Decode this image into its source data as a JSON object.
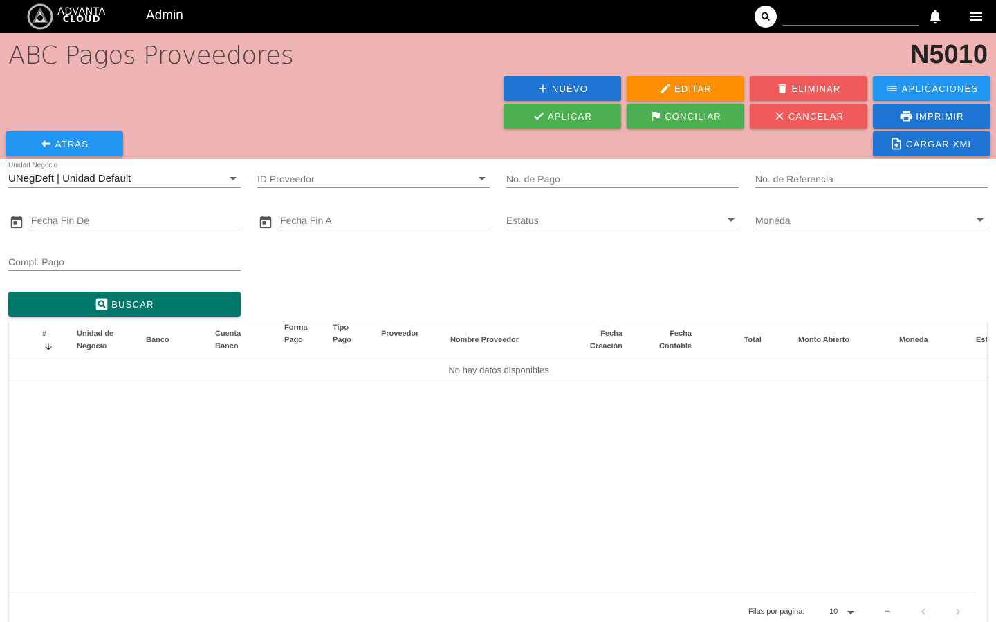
{
  "app": {
    "logo_line1": "ADVANTA",
    "logo_line2": "CLOUD",
    "title": "Admin",
    "search_placeholder": ""
  },
  "header": {
    "title": "ABC Pagos Proveedores",
    "code": "N5010"
  },
  "actions": {
    "nuevo": "NUEVO",
    "editar": "EDITAR",
    "eliminar": "ELIMINAR",
    "aplicaciones": "APLICACIONES",
    "aplicar": "APLICAR",
    "conciliar": "CONCILIAR",
    "cancelar": "CANCELAR",
    "imprimir": "IMPRIMIR",
    "atras": "ATRÁS",
    "cargar_xml": "CARGAR XML"
  },
  "filters": {
    "unidad_negocio_label": "Unidad Negocio",
    "unidad_negocio_value": "UNegDeft | Unidad Default",
    "id_proveedor": "ID Proveedor",
    "no_pago": "No. de Pago",
    "no_referencia": "No. de Referencia",
    "fecha_fin_de": "Fecha Fin De",
    "fecha_fin_a": "Fecha Fin A",
    "estatus": "Estatus",
    "moneda": "Moneda",
    "compl_pago": "Compl. Pago",
    "buscar": "BUSCAR"
  },
  "table": {
    "headers": {
      "num": "#",
      "unidad_l1": "Unidad de",
      "unidad_l2": "Negocio",
      "banco": "Banco",
      "cuenta_l1": "Cuenta",
      "cuenta_l2": "Banco",
      "forma_l1": "Forma",
      "forma_l2": "Pago",
      "tipo_l1": "Tipo",
      "tipo_l2": "Pago",
      "proveedor": "Proveedor",
      "nombre_proveedor": "Nombre Proveedor",
      "fecha_creacion_l1": "Fecha",
      "fecha_creacion_l2": "Creación",
      "fecha_contable_l1": "Fecha",
      "fecha_contable_l2": "Contable",
      "total": "Total",
      "monto_abierto": "Monto Abierto",
      "moneda": "Moneda",
      "estatus_partial": "Esta"
    },
    "empty_message": "No hay datos disponibles",
    "rows_per_page_label": "Filas por página:",
    "rows_per_page_value": "10",
    "range": "–"
  },
  "colors": {
    "appbar": "#000000",
    "band": "#efb3b3",
    "blue": "#1e74d2",
    "light_blue": "#2196f3",
    "orange": "#ff8f00",
    "red": "#f05a5a",
    "green": "#4caf50",
    "teal": "#00796b"
  }
}
